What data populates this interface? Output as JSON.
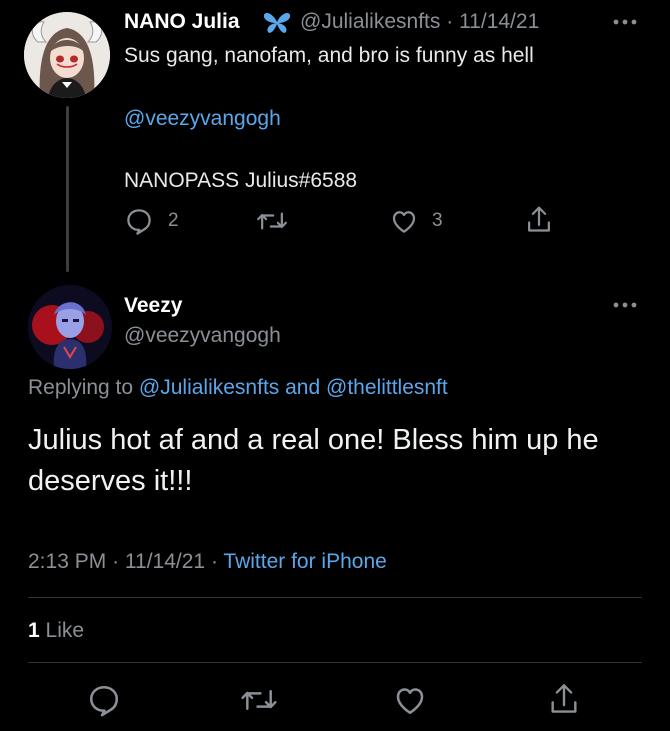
{
  "parent_tweet": {
    "display_name": "NANO Julia",
    "verified_icon": "butterfly-icon",
    "handle": "@Julialikesnfts",
    "separator": "·",
    "date": "11/14/21",
    "text": "Sus gang, nanofam, and bro is funny as hell",
    "mention": "@veezyvangogh",
    "nanopass": "NANOPASS Julius#6588",
    "reply_count": "2",
    "like_count": "3"
  },
  "main_tweet": {
    "display_name": "Veezy",
    "handle": "@veezyvangogh",
    "replying_prefix": "Replying to",
    "replying_user1": "@Julialikesnfts",
    "replying_and": "and",
    "replying_user2": "@thelittlesnft",
    "body": "Julius hot af and a real one! Bless him up he deserves it!!!",
    "time": "2:13 PM",
    "separator": "·",
    "date": "11/14/21",
    "source": "Twitter for iPhone",
    "like_count": "1",
    "like_label": "Like"
  },
  "colors": {
    "background": "#000000",
    "text": "#e7e9ea",
    "muted": "#8b9096",
    "link": "#5aa7ec",
    "divider": "#2f3336"
  },
  "icons": [
    "reply-icon",
    "retweet-icon",
    "like-icon",
    "share-icon",
    "more-icon",
    "butterfly-icon"
  ]
}
